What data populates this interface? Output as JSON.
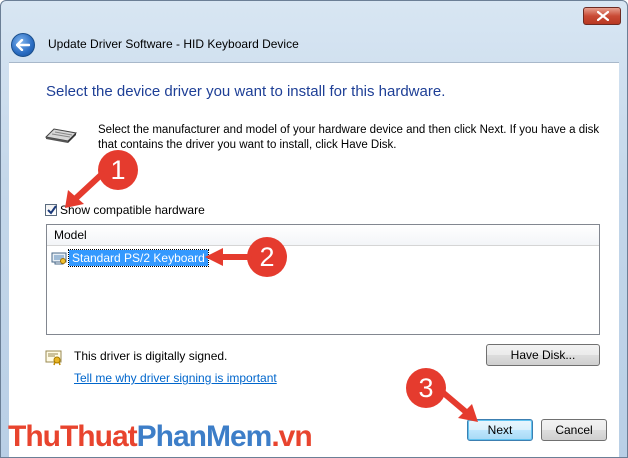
{
  "window": {
    "title": "Update Driver Software - HID Keyboard Device"
  },
  "page": {
    "heading": "Select the device driver you want to install for this hardware.",
    "instruction": "Select the manufacturer and model of your hardware device and then click Next. If you have a disk that contains the driver you want to install, click Have Disk."
  },
  "compatible": {
    "label": "Show compatible hardware",
    "checked": true
  },
  "model_list": {
    "header": "Model",
    "items": [
      {
        "label": "Standard PS/2 Keyboard",
        "selected": true
      }
    ]
  },
  "signing": {
    "status": "This driver is digitally signed.",
    "link": "Tell me why driver signing is important"
  },
  "buttons": {
    "have_disk": "Have Disk...",
    "next": "Next",
    "cancel": "Cancel"
  },
  "annotations": {
    "markers": [
      "1",
      "2",
      "3"
    ],
    "color": "#e53b2e"
  },
  "watermark": {
    "part1": "ThuThuat",
    "part2": "PhanMem",
    "part3": ".vn"
  },
  "colors": {
    "heading": "#1e3f96",
    "link": "#0066cc",
    "selection": "#3399ff"
  }
}
